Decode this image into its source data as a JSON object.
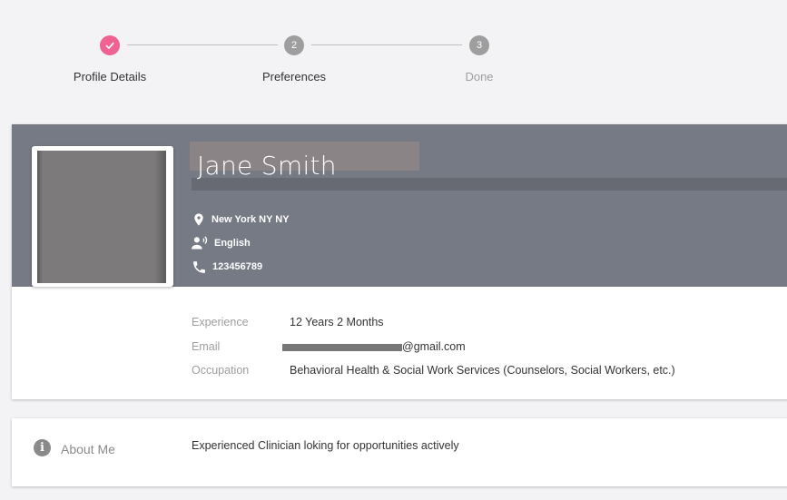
{
  "stepper": {
    "steps": [
      {
        "label": "Profile Details",
        "number": "",
        "state": "completed"
      },
      {
        "label": "Preferences",
        "number": "2",
        "state": "active"
      },
      {
        "label": "Done",
        "number": "3",
        "state": "inactive"
      }
    ],
    "colors": {
      "completed": "#f06292",
      "active": "#9e9e9e",
      "inactive": "#9e9e9e"
    }
  },
  "profile": {
    "name": "Jane Smith",
    "location": "New York NY NY",
    "language": "English",
    "phone": "123456789",
    "banner_color": "#767a85",
    "location_icon": "map-pin-icon",
    "language_icon": "speaker-person-icon",
    "phone_icon": "phone-icon"
  },
  "details": {
    "experience_label": "Experience",
    "experience_value": "12 Years 2 Months",
    "email_label": "Email",
    "email_value": "@gmail.com",
    "occupation_label": "Occupation",
    "occupation_value": "Behavioral Health & Social Work Services (Counselors, Social Workers, etc.)"
  },
  "about": {
    "title": "About Me",
    "icon": "info-icon",
    "text": "Experienced Clinician loking for opportunities actively"
  }
}
